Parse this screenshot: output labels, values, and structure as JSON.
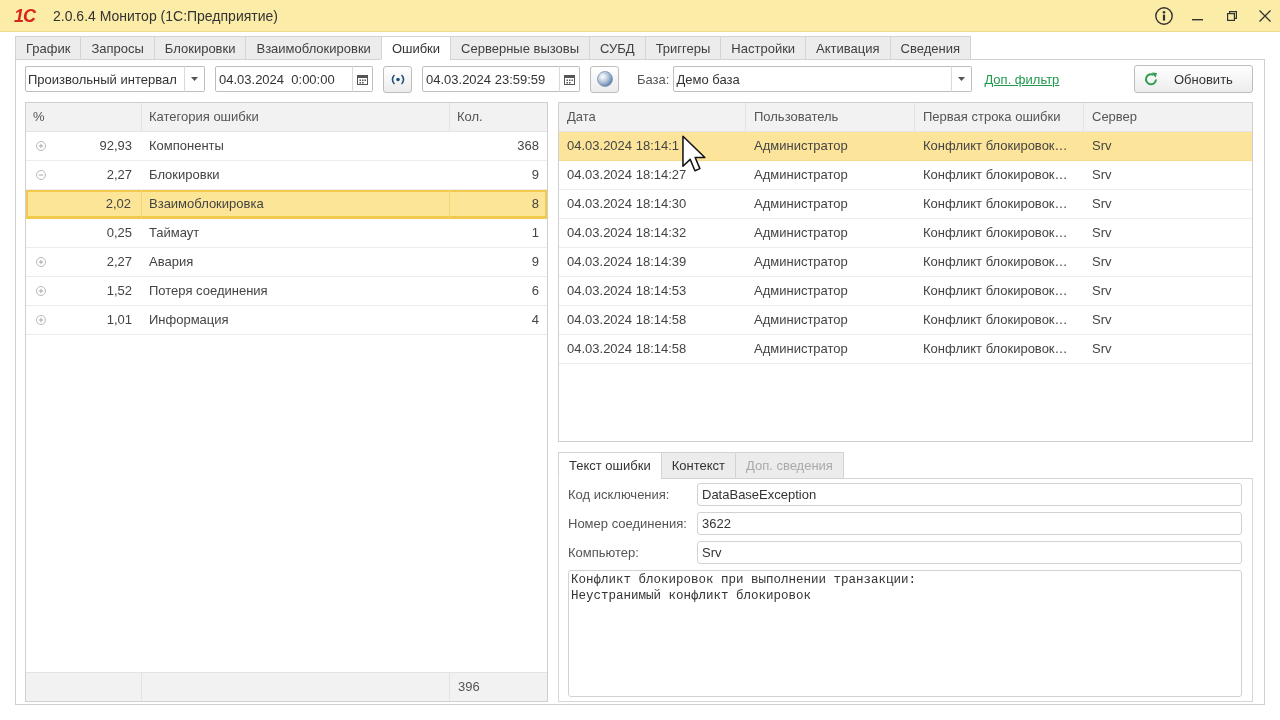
{
  "window": {
    "logo": "1С",
    "title": "2.0.6.4 Монитор (1С:Предприятие)"
  },
  "tabs": [
    {
      "label": "График",
      "selected": false
    },
    {
      "label": "Запросы",
      "selected": false
    },
    {
      "label": "Блокировки",
      "selected": false
    },
    {
      "label": "Взаимоблокировки",
      "selected": false
    },
    {
      "label": "Ошибки",
      "selected": true
    },
    {
      "label": "Серверные вызовы",
      "selected": false
    },
    {
      "label": "СУБД",
      "selected": false
    },
    {
      "label": "Триггеры",
      "selected": false
    },
    {
      "label": "Настройки",
      "selected": false
    },
    {
      "label": "Активация",
      "selected": false
    },
    {
      "label": "Сведения",
      "selected": false
    }
  ],
  "toolbar": {
    "period": {
      "value": "Произвольный интервал"
    },
    "date_from": {
      "value": "04.03.2024  0:00:00"
    },
    "date_to": {
      "value": "04.03.2024 23:59:59"
    },
    "base": {
      "label": "База:",
      "value": "Демо база"
    },
    "filter_link": "Доп. фильтр",
    "refresh_button": "Обновить"
  },
  "categories": {
    "columns": [
      "%",
      "Категория ошибки",
      "Кол."
    ],
    "rows": [
      {
        "percent": "92,93",
        "name": "Компоненты",
        "count": "368",
        "expanded": false,
        "selected": false
      },
      {
        "percent": "2,27",
        "name": "Блокировки",
        "count": "9",
        "expanded": true,
        "selected": false,
        "children": [
          {
            "percent": "2,02",
            "name": "Взаимоблокировка",
            "count": "8",
            "selected": true
          },
          {
            "percent": "0,25",
            "name": "Таймаут",
            "count": "1",
            "selected": false
          }
        ]
      },
      {
        "percent": "2,27",
        "name": "Авария",
        "count": "9",
        "expanded": false,
        "selected": false
      },
      {
        "percent": "1,52",
        "name": "Потеря соединения",
        "count": "6",
        "expanded": false,
        "selected": false
      },
      {
        "percent": "1,01",
        "name": "Информация",
        "count": "4",
        "expanded": false,
        "selected": false
      }
    ],
    "total": "396"
  },
  "errors": {
    "columns": [
      "Дата",
      "Пользователь",
      "Первая строка ошибки",
      "Сервер"
    ],
    "rows": [
      {
        "date": "04.03.2024 18:14:1",
        "user": "Администратор",
        "first_line": "Конфликт блокировок…",
        "server": "Srv",
        "selected": true
      },
      {
        "date": "04.03.2024 18:14:27",
        "user": "Администратор",
        "first_line": "Конфликт блокировок…",
        "server": "Srv",
        "selected": false
      },
      {
        "date": "04.03.2024 18:14:30",
        "user": "Администратор",
        "first_line": "Конфликт блокировок…",
        "server": "Srv",
        "selected": false
      },
      {
        "date": "04.03.2024 18:14:32",
        "user": "Администратор",
        "first_line": "Конфликт блокировок…",
        "server": "Srv",
        "selected": false
      },
      {
        "date": "04.03.2024 18:14:39",
        "user": "Администратор",
        "first_line": "Конфликт блокировок…",
        "server": "Srv",
        "selected": false
      },
      {
        "date": "04.03.2024 18:14:53",
        "user": "Администратор",
        "first_line": "Конфликт блокировок…",
        "server": "Srv",
        "selected": false
      },
      {
        "date": "04.03.2024 18:14:58",
        "user": "Администратор",
        "first_line": "Конфликт блокировок…",
        "server": "Srv",
        "selected": false
      },
      {
        "date": "04.03.2024 18:14:58",
        "user": "Администратор",
        "first_line": "Конфликт блокировок…",
        "server": "Srv",
        "selected": false
      }
    ]
  },
  "details": {
    "tabs": [
      {
        "label": "Текст ошибки",
        "selected": true,
        "disabled": false
      },
      {
        "label": "Контекст",
        "selected": false,
        "disabled": false
      },
      {
        "label": "Доп. сведения",
        "selected": false,
        "disabled": true
      }
    ],
    "fields": [
      {
        "label": "Код исключения:",
        "value": "DataBaseException"
      },
      {
        "label": "Номер соединения:",
        "value": "3622"
      },
      {
        "label": "Компьютер:",
        "value": "Srv"
      }
    ],
    "text": "Конфликт блокировок при выполнении транзакции:\nНеустранимый конфликт блокировок"
  }
}
